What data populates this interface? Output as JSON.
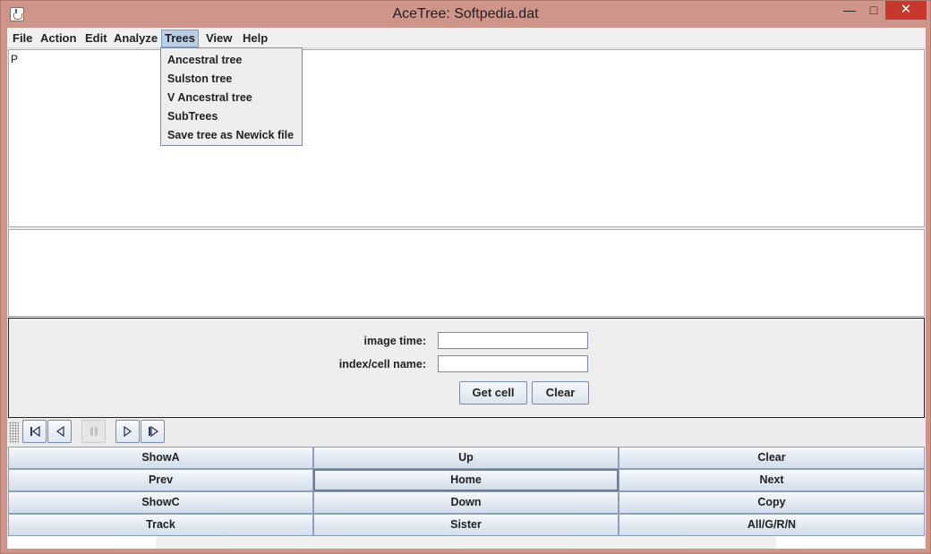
{
  "window": {
    "title": "AceTree: Softpedia.dat",
    "min_glyph": "—",
    "max_glyph": "□",
    "close_glyph": "✕"
  },
  "menubar": {
    "items": [
      {
        "label": "File"
      },
      {
        "label": "Action"
      },
      {
        "label": "Edit"
      },
      {
        "label": "Analyze"
      },
      {
        "label": "Trees"
      },
      {
        "label": "View"
      },
      {
        "label": "Help"
      }
    ],
    "active_menu": "Trees"
  },
  "trees_menu": {
    "items": [
      {
        "label": "Ancestral tree"
      },
      {
        "label": "Sulston tree"
      },
      {
        "label": "V Ancestral tree"
      },
      {
        "label": "SubTrees"
      },
      {
        "label": "Save tree as Newick file"
      }
    ]
  },
  "tree_panel": {
    "text": "P"
  },
  "form": {
    "image_time_label": "image time:",
    "image_time_value": "",
    "cell_name_label": "index/cell name:",
    "cell_name_value": "",
    "get_cell_button": "Get cell",
    "clear_button": "Clear"
  },
  "nav": {
    "buttons": [
      {
        "icon": "step-back-icon",
        "enabled": true
      },
      {
        "icon": "play-back-icon",
        "enabled": true
      },
      {
        "icon": "pause-icon",
        "enabled": false
      },
      {
        "icon": "play-forward-icon",
        "enabled": true
      },
      {
        "icon": "step-forward-icon",
        "enabled": true
      }
    ]
  },
  "grid": {
    "rows": [
      [
        "ShowA",
        "Up",
        "Clear"
      ],
      [
        "Prev",
        "Home",
        "Next"
      ],
      [
        "ShowC",
        "Down",
        "Copy"
      ],
      [
        "Track",
        "Sister",
        "All/G/R/N"
      ]
    ]
  },
  "colors": {
    "window_frame": "#cf958b",
    "close_button": "#c7372b",
    "menu_highlight": "#b8cfe5"
  }
}
